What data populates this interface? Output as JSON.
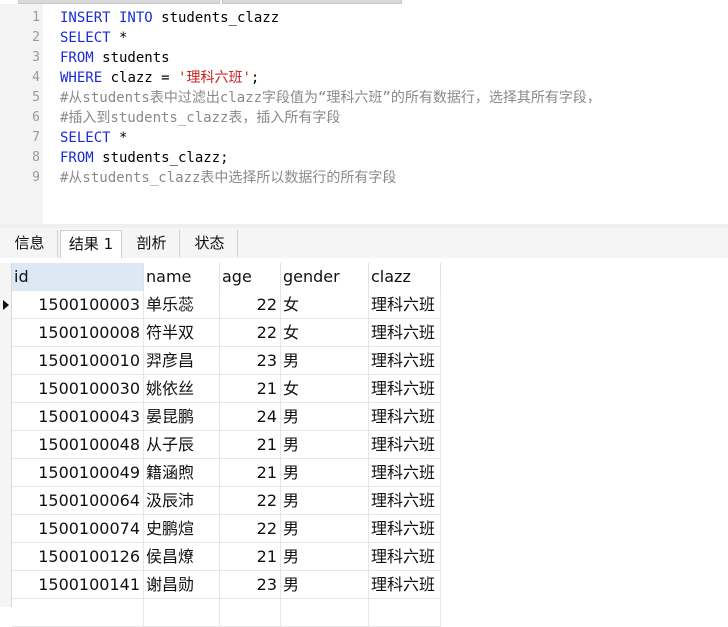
{
  "editor": {
    "lines": [
      {
        "num": "1",
        "parts": [
          {
            "t": "INSERT INTO",
            "c": "kw"
          },
          {
            "t": " students_clazz",
            "c": ""
          }
        ]
      },
      {
        "num": "2",
        "parts": [
          {
            "t": "SELECT",
            "c": "kw"
          },
          {
            "t": " *",
            "c": ""
          }
        ]
      },
      {
        "num": "3",
        "parts": [
          {
            "t": "FROM",
            "c": "kw"
          },
          {
            "t": " students",
            "c": ""
          }
        ]
      },
      {
        "num": "4",
        "parts": [
          {
            "t": "WHERE",
            "c": "kw"
          },
          {
            "t": " clazz = ",
            "c": ""
          },
          {
            "t": "'理科六班'",
            "c": "str"
          },
          {
            "t": ";",
            "c": ""
          }
        ]
      },
      {
        "num": "5",
        "parts": [
          {
            "t": "#从students表中过滤出clazz字段值为“理科六班”的所有数据行，选择其所有字段，",
            "c": "cm"
          }
        ]
      },
      {
        "num": "6",
        "parts": [
          {
            "t": "#插入到students_clazz表，插入所有字段",
            "c": "cm"
          }
        ]
      },
      {
        "num": "7",
        "parts": [
          {
            "t": "SELECT",
            "c": "kw"
          },
          {
            "t": " *",
            "c": ""
          }
        ]
      },
      {
        "num": "8",
        "parts": [
          {
            "t": "FROM",
            "c": "kw"
          },
          {
            "t": " students_clazz;",
            "c": ""
          }
        ]
      },
      {
        "num": "9",
        "parts": [
          {
            "t": "#从students_clazz表中选择所以数据行的所有字段",
            "c": "cm"
          }
        ]
      }
    ]
  },
  "tabs": [
    {
      "label": "信息"
    },
    {
      "label": "结果 1"
    },
    {
      "label": "剖析"
    },
    {
      "label": "状态"
    }
  ],
  "table": {
    "columns": [
      "id",
      "name",
      "age",
      "gender",
      "clazz"
    ],
    "rows": [
      [
        "1500100003",
        "单乐蕊",
        "22",
        "女",
        "理科六班"
      ],
      [
        "1500100008",
        "符半双",
        "22",
        "女",
        "理科六班"
      ],
      [
        "1500100010",
        "羿彦昌",
        "23",
        "男",
        "理科六班"
      ],
      [
        "1500100030",
        "姚依丝",
        "21",
        "女",
        "理科六班"
      ],
      [
        "1500100043",
        "晏昆鹏",
        "24",
        "男",
        "理科六班"
      ],
      [
        "1500100048",
        "从子辰",
        "21",
        "男",
        "理科六班"
      ],
      [
        "1500100049",
        "籍涵煦",
        "21",
        "男",
        "理科六班"
      ],
      [
        "1500100064",
        "汲辰沛",
        "22",
        "男",
        "理科六班"
      ],
      [
        "1500100074",
        "史鹏煊",
        "22",
        "男",
        "理科六班"
      ],
      [
        "1500100126",
        "侯昌燎",
        "21",
        "男",
        "理科六班"
      ],
      [
        "1500100141",
        "谢昌勋",
        "23",
        "男",
        "理科六班"
      ]
    ]
  }
}
